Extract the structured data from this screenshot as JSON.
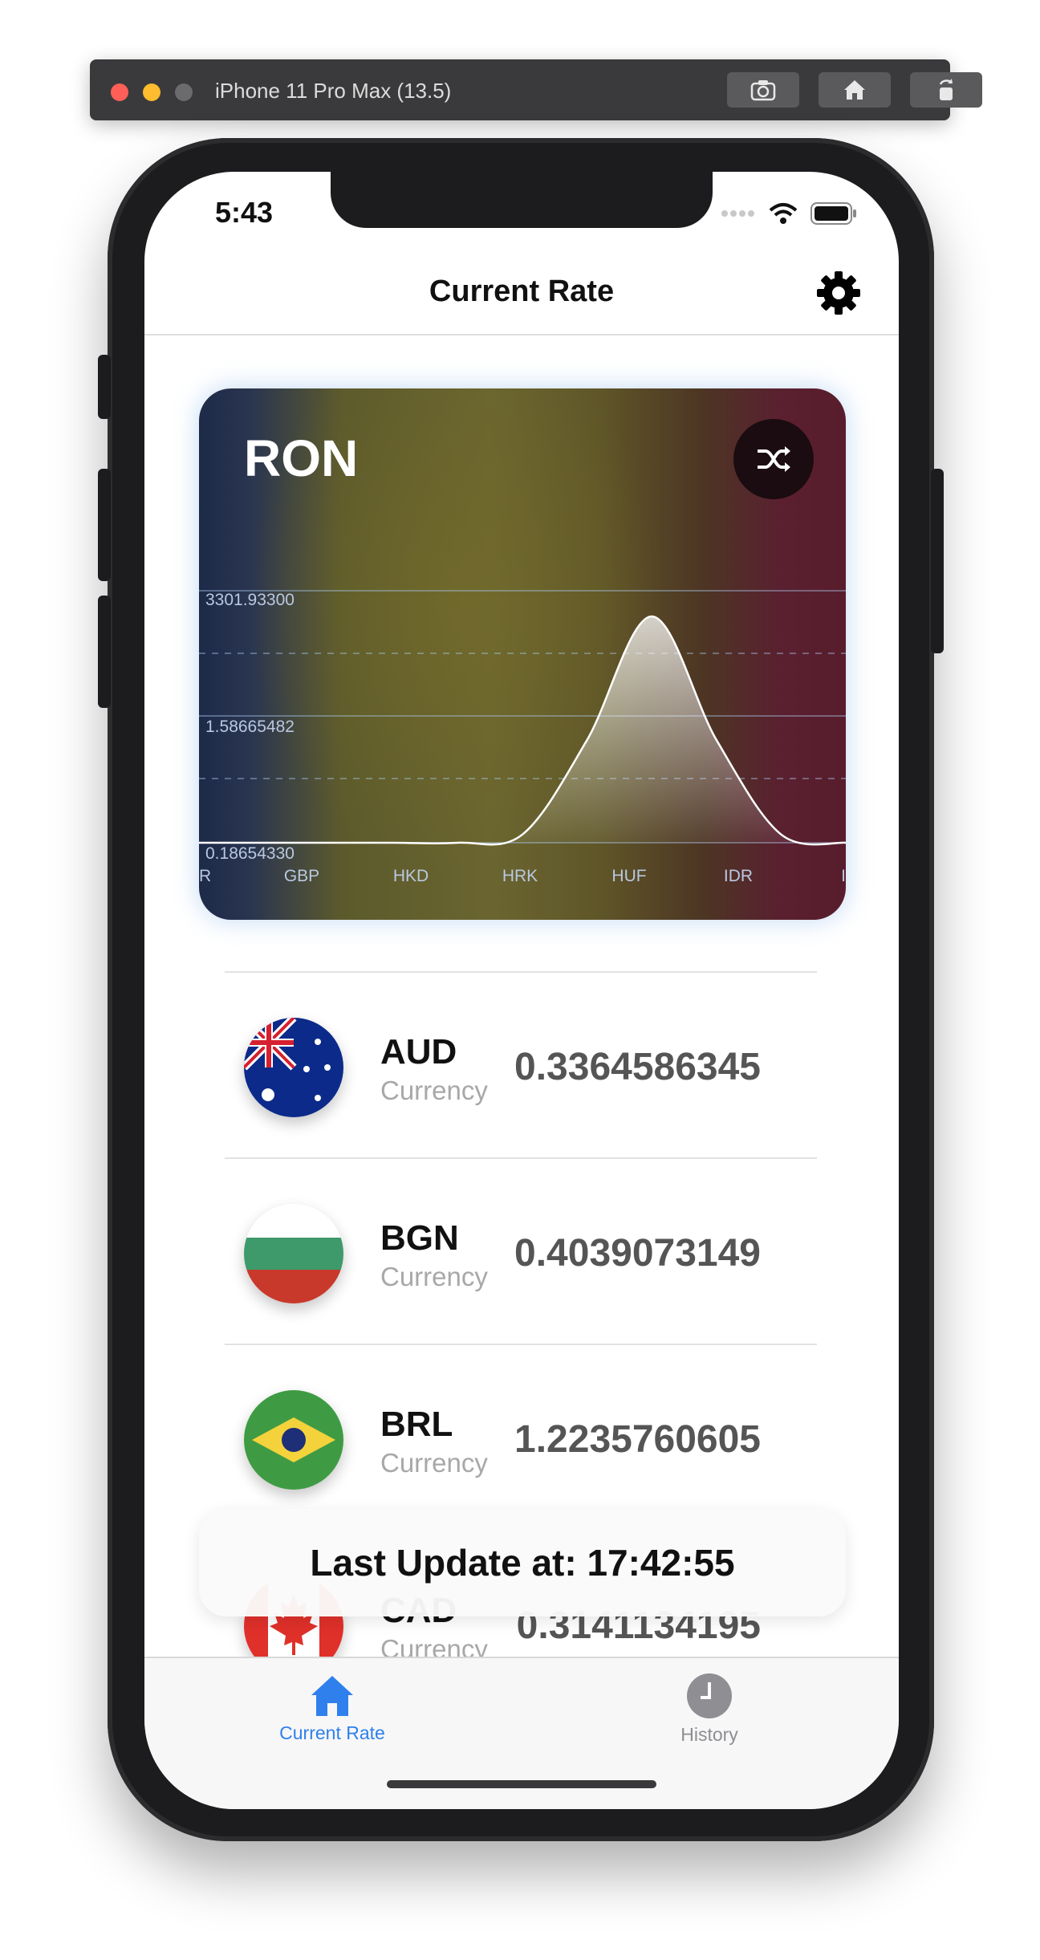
{
  "window": {
    "title": "iPhone 11 Pro Max (13.5)"
  },
  "status_bar": {
    "time": "5:43"
  },
  "nav": {
    "title": "Current Rate"
  },
  "card": {
    "base_currency": "RON"
  },
  "chart_data": {
    "type": "area",
    "categories": [
      "R",
      "GBP",
      "HKD",
      "HRK",
      "HUF",
      "IDR",
      "I"
    ],
    "series": [
      {
        "values": [
          0.186,
          0.186,
          0.186,
          0.186,
          0.186,
          0.3,
          1.6,
          3.3,
          1.6,
          0.3,
          0.186
        ]
      }
    ],
    "y_tick_labels": [
      "3301.93300",
      "1.58665482",
      "0.18654330"
    ],
    "grid": true
  },
  "currencies": [
    {
      "code": "AUD",
      "label": "Currency",
      "value": "0.3364586345",
      "flag": "australia-flag"
    },
    {
      "code": "BGN",
      "label": "Currency",
      "value": "0.4039073149",
      "flag": "bulgaria-flag"
    },
    {
      "code": "BRL",
      "label": "Currency",
      "value": "1.2235760605",
      "flag": "brazil-flag"
    },
    {
      "code": "CAD",
      "label": "Currency",
      "value": "0.3141134195",
      "flag": "canada-flag"
    }
  ],
  "toast": {
    "text": "Last Update at: 17:42:55"
  },
  "tabs": [
    {
      "label": "Current Rate",
      "icon": "house-icon",
      "active": true
    },
    {
      "label": "History",
      "icon": "clock-icon",
      "active": false
    }
  ],
  "colors": {
    "accent": "#2f80ed",
    "inactive": "#8e8e93"
  }
}
